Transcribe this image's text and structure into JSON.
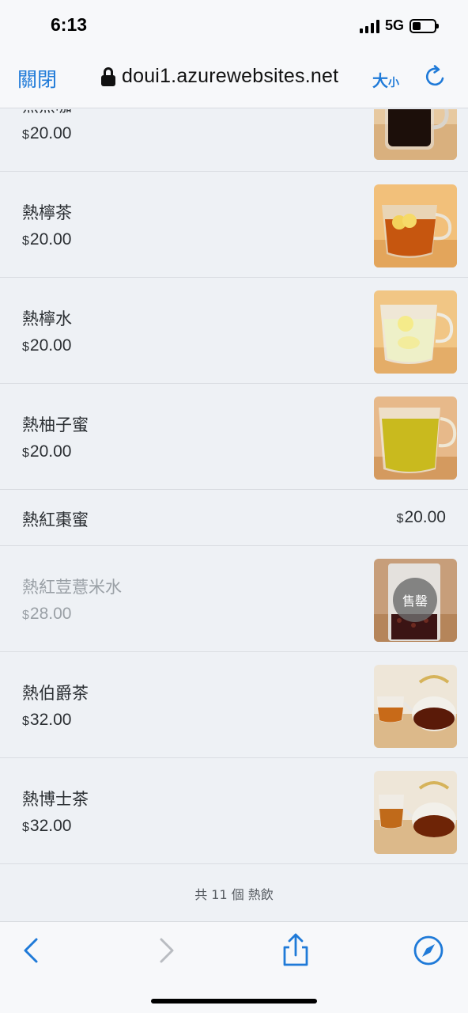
{
  "status": {
    "time": "6:13",
    "network": "5G"
  },
  "browser": {
    "close_label": "關閉",
    "url": "doui1.azurewebsites.net",
    "text_size_big": "大",
    "text_size_small": "小"
  },
  "items": [
    {
      "name": "熱黑咖",
      "currency": "$",
      "price": "20.00"
    },
    {
      "name": "熱檸茶",
      "currency": "$",
      "price": "20.00"
    },
    {
      "name": "熱檸水",
      "currency": "$",
      "price": "20.00"
    },
    {
      "name": "熱柚子蜜",
      "currency": "$",
      "price": "20.00"
    },
    {
      "name": "熱紅棗蜜",
      "currency": "$",
      "price": "20.00"
    },
    {
      "name": "熱紅荳薏米水",
      "currency": "$",
      "price": "28.00",
      "badge": "售罄"
    },
    {
      "name": "熱伯爵茶",
      "currency": "$",
      "price": "32.00"
    },
    {
      "name": "熱博士茶",
      "currency": "$",
      "price": "32.00"
    }
  ],
  "total_label": "共 11 個 熱飲",
  "colors": {
    "accent": "#1f7ad8",
    "background": "#eef1f5"
  }
}
